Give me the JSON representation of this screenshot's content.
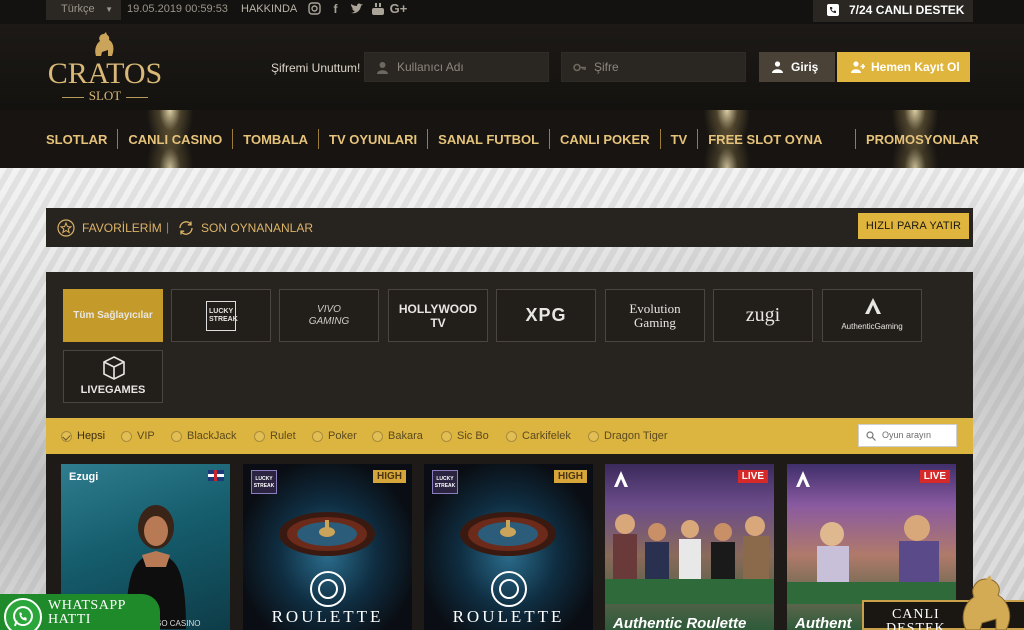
{
  "topbar": {
    "language": "Türkçe",
    "datetime": "19.05.2019 00:59:53",
    "about": "HAKKINDA",
    "social": [
      "instagram-icon",
      "facebook-icon",
      "twitter-icon",
      "youtube-icon",
      "google-plus-icon"
    ],
    "support": "7/24 CANLI DESTEK"
  },
  "header": {
    "logo_name": "CRATOS",
    "logo_sub": "SLOT",
    "forgot_password": "Şifremi Unuttum!",
    "username_placeholder": "Kullanıcı Adı",
    "password_placeholder": "Şifre",
    "login_label": "Giriş",
    "register_label": "Hemen Kayıt Ol"
  },
  "nav": {
    "items": [
      "SLOTLAR",
      "CANLI CASINO",
      "TOMBALA",
      "TV OYUNLARI",
      "SANAL FUTBOL",
      "CANLI POKER",
      "TV",
      "FREE SLOT OYNA"
    ],
    "promo": "PROMOSYONLAR"
  },
  "favbar": {
    "favorites": "FAVORİLERİM",
    "separator": "|",
    "recent": "SON OYNANANLAR",
    "deposit": "HIZLI PARA YATIR"
  },
  "providers": {
    "all": "Tüm Sağlayıcılar",
    "items": [
      "LUCKY STREAK",
      "VIVO GAMING",
      "HOLLYWOOD TV",
      "XPG",
      "Evolution Gaming",
      "zugi",
      "AuthenticGaming",
      "LIVEGAMES"
    ]
  },
  "filters": {
    "items": [
      "Hepsi",
      "VIP",
      "BlackJack",
      "Rulet",
      "Poker",
      "Bakara",
      "Sic Bo",
      "Carkifelek",
      "Dragon Tiger"
    ],
    "selected": "Hepsi",
    "search_placeholder": "Oyun arayın"
  },
  "games": [
    {
      "provider": "Ezugi",
      "caption": "SO CASINO",
      "badge": ""
    },
    {
      "provider": "LUCKY STREAK",
      "caption": "ROULETTE",
      "badge": "HIGH"
    },
    {
      "provider": "LUCKY STREAK",
      "caption": "ROULETTE",
      "badge": "HIGH"
    },
    {
      "provider": "Authentic Gaming",
      "caption": "Authentic Roulette",
      "badge": "LIVE"
    },
    {
      "provider": "Authentic Gaming",
      "caption": "Authent",
      "badge": "LIVE"
    }
  ],
  "floating": {
    "whatsapp_line1": "WHATSAPP",
    "whatsapp_line2": "HATTI",
    "support_line1": "CANLI",
    "support_line2": "DESTEK"
  },
  "colors": {
    "gold": "#dcb440",
    "gold_text": "#e6c37a",
    "dark": "#171411",
    "live": "#d62a2a"
  }
}
